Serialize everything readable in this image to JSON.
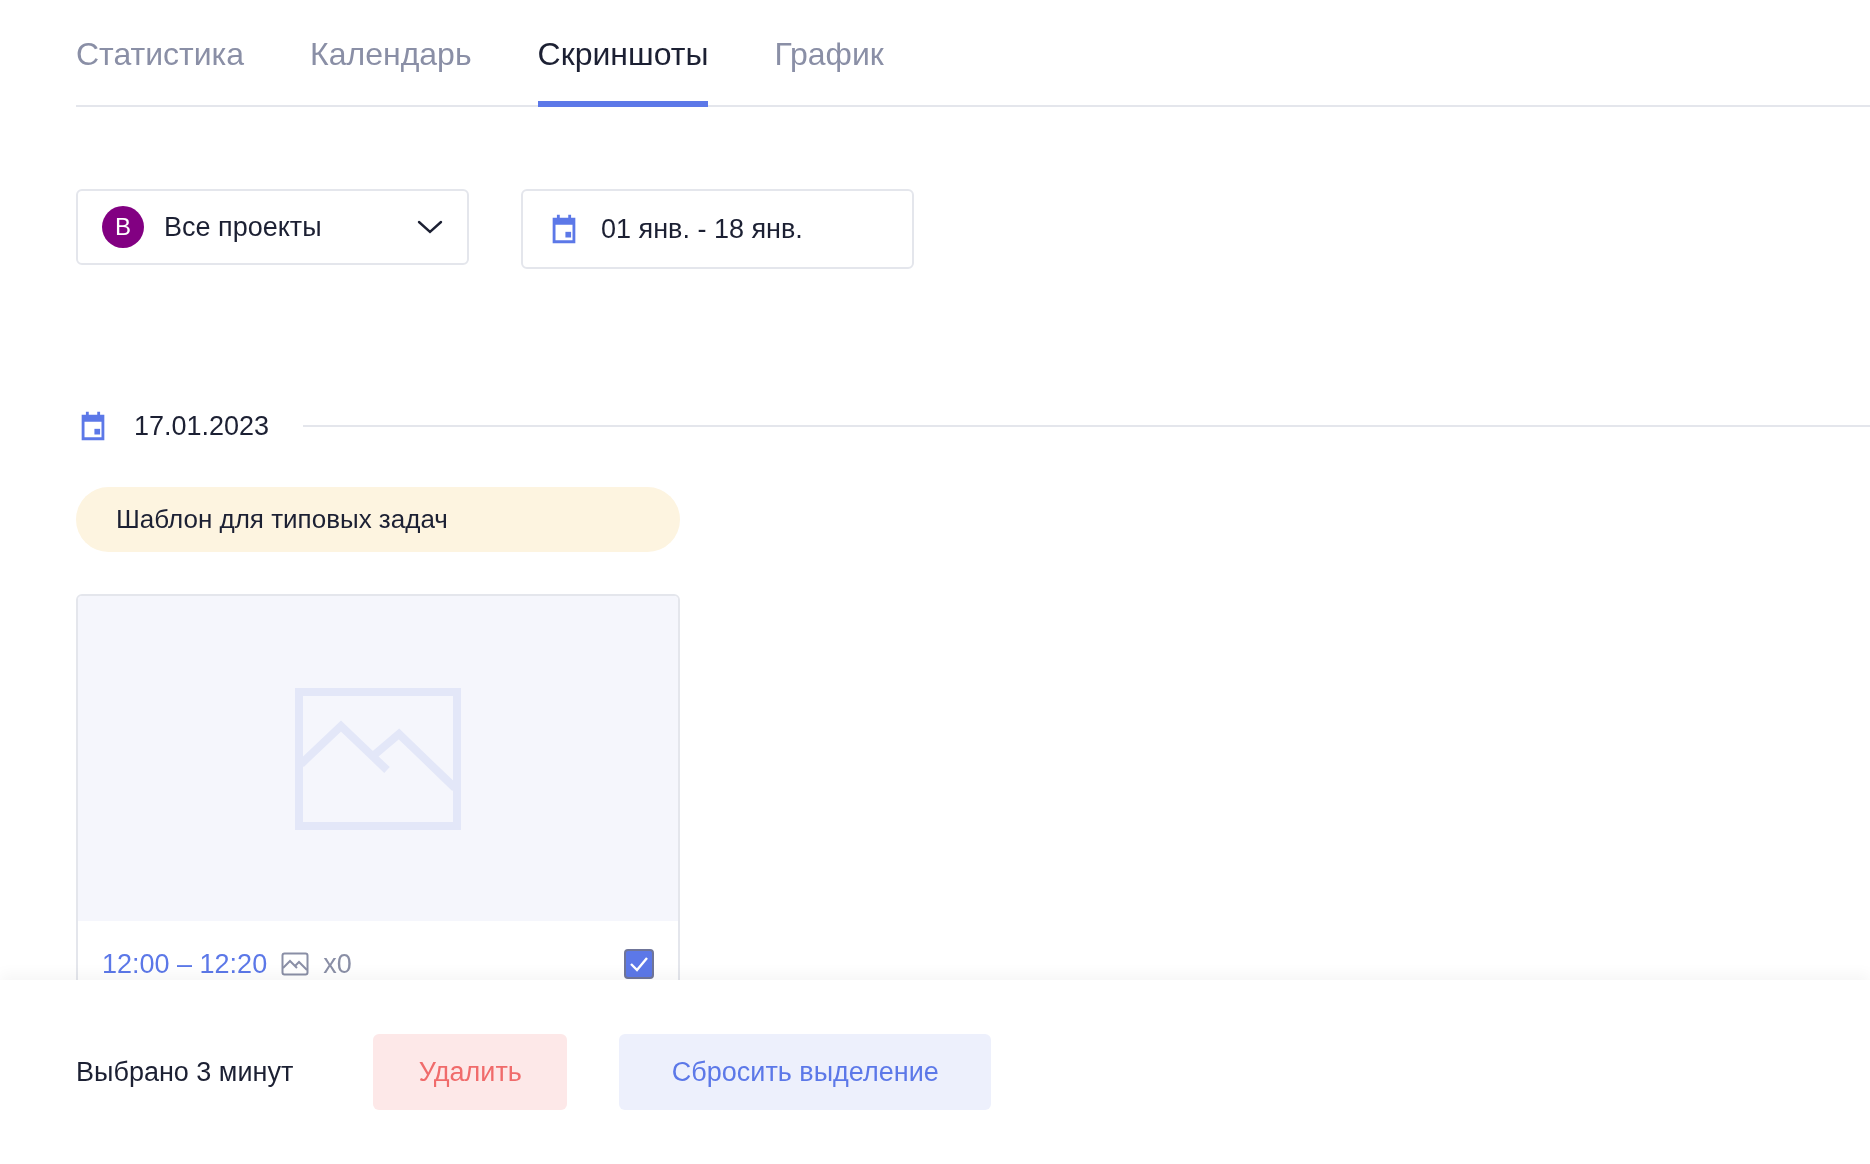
{
  "tabs": [
    {
      "label": "Статистика",
      "selected": false
    },
    {
      "label": "Календарь",
      "selected": false
    },
    {
      "label": "Скриншоты",
      "selected": true
    },
    {
      "label": "График",
      "selected": false
    }
  ],
  "project_filter": {
    "avatar": "В",
    "value": "Все проекты"
  },
  "date_filter": {
    "value": "01 янв. - 18 янв."
  },
  "days": [
    {
      "date": "17.01.2023",
      "groups": [
        {
          "task": "Шаблон для типовых задач",
          "screenshots": [
            {
              "kind": "picture",
              "time": "12:00 – 12:20",
              "count": "x0",
              "checked": true
            }
          ]
        }
      ]
    }
  ],
  "selection_bar": {
    "summary": "Выбрано 3 минут",
    "delete_button": "Удалить",
    "reset_button": "Сбросить выделение"
  }
}
